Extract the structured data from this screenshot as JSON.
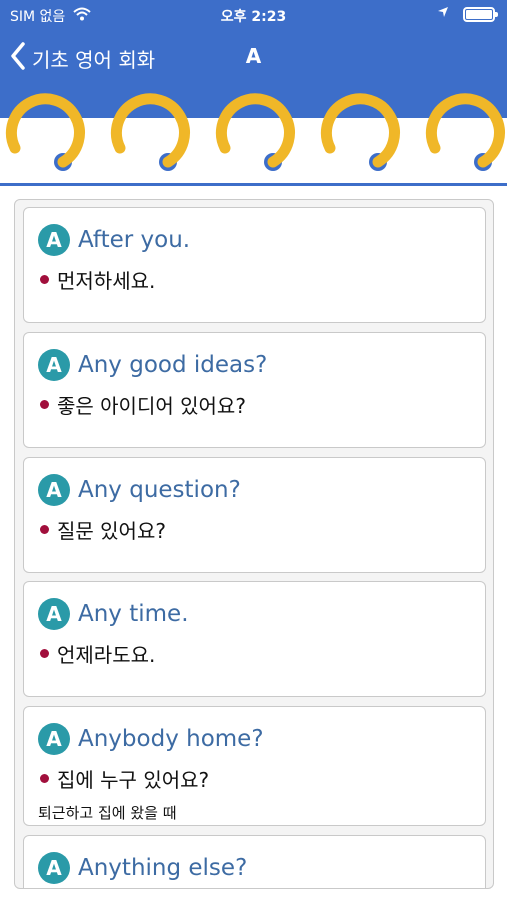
{
  "status": {
    "carrier": "SIM 없음",
    "time": "오후 2:23"
  },
  "nav": {
    "back_label": "기초 영어 회화",
    "title": "A"
  },
  "items": [
    {
      "badge": "A",
      "phrase": "After you.",
      "meaning": "먼저하세요.",
      "note": ""
    },
    {
      "badge": "A",
      "phrase": "Any good ideas?",
      "meaning": "좋은 아이디어 있어요?",
      "note": ""
    },
    {
      "badge": "A",
      "phrase": "Any question?",
      "meaning": "질문 있어요?",
      "note": ""
    },
    {
      "badge": "A",
      "phrase": "Any time.",
      "meaning": "언제라도요.",
      "note": ""
    },
    {
      "badge": "A",
      "phrase": "Anybody home?",
      "meaning": "집에 누구 있어요?",
      "note": "퇴근하고 집에 왔을 때"
    },
    {
      "badge": "A",
      "phrase": "Anything else?",
      "meaning": "",
      "note": ""
    }
  ],
  "colors": {
    "primary": "#3d6ec9",
    "ring": "#f0b728",
    "badge": "#2a9aa8",
    "phrase": "#3d6ba3",
    "bullet": "#a10f3c"
  }
}
